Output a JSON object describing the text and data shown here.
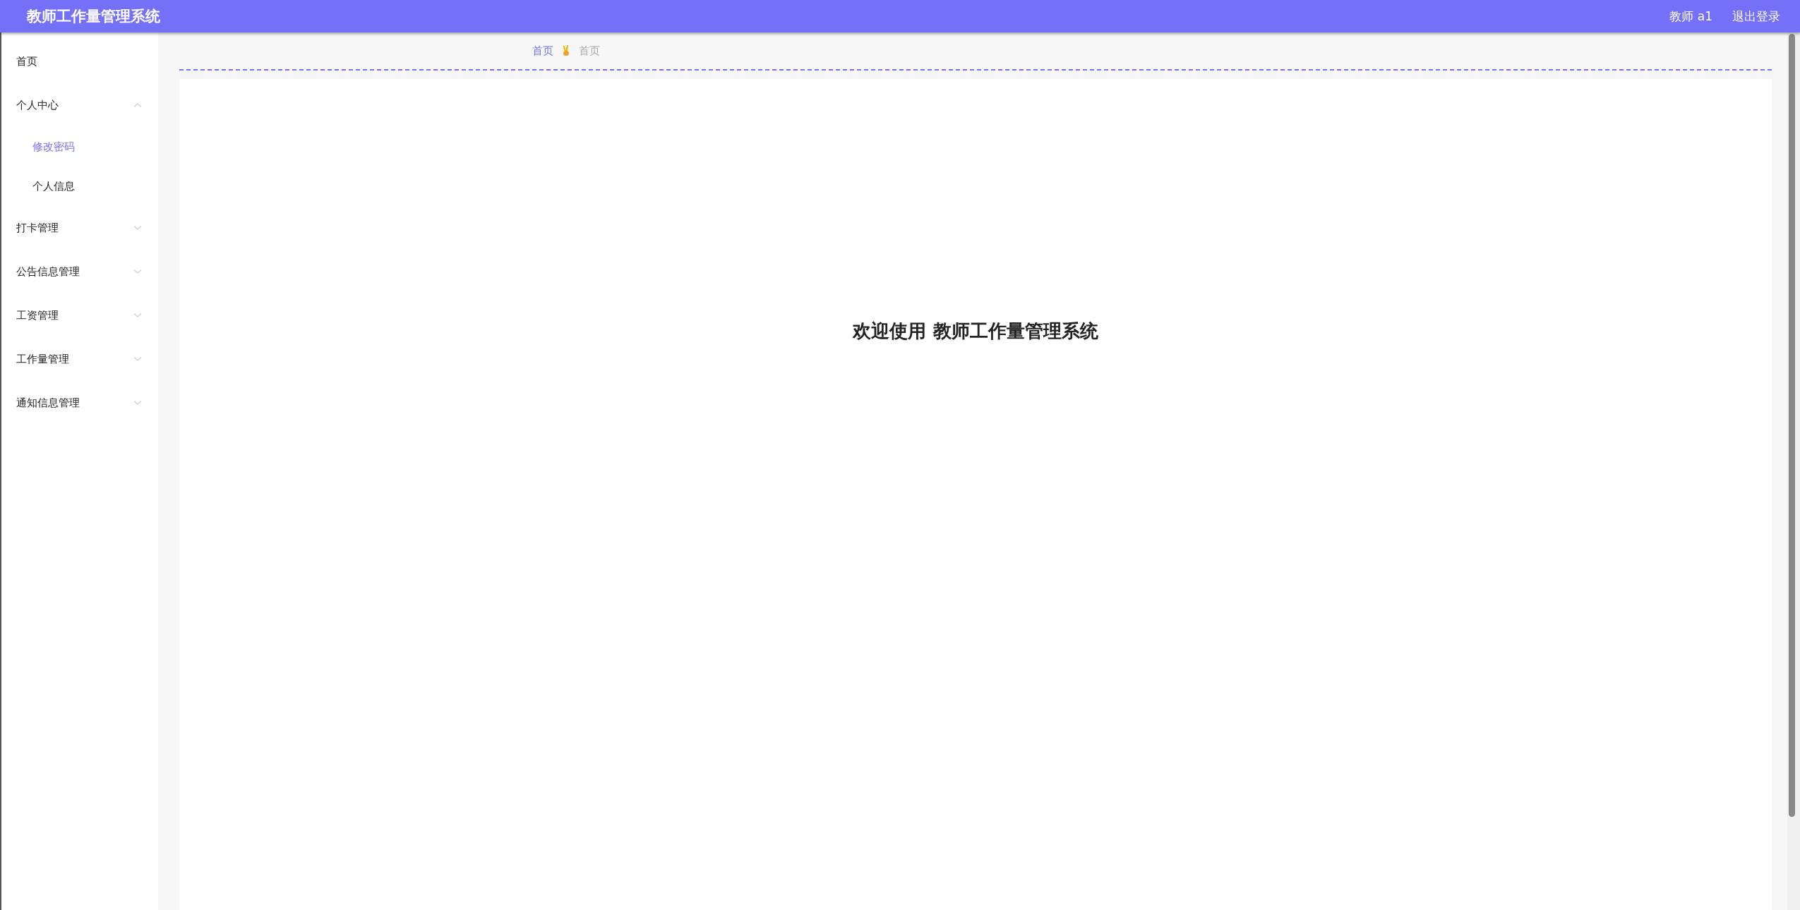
{
  "header": {
    "title": "教师工作量管理系统",
    "user": "教师 a1",
    "logout": "退出登录"
  },
  "sidebar": {
    "items": [
      {
        "kind": "link",
        "label": "首页",
        "selected": false
      },
      {
        "kind": "group",
        "label": "个人中心",
        "expanded": true,
        "children": [
          {
            "label": "修改密码",
            "selected": true
          },
          {
            "label": "个人信息",
            "selected": false
          }
        ]
      },
      {
        "kind": "group",
        "label": "打卡管理",
        "expanded": false
      },
      {
        "kind": "group",
        "label": "公告信息管理",
        "expanded": false
      },
      {
        "kind": "group",
        "label": "工资管理",
        "expanded": false
      },
      {
        "kind": "group",
        "label": "工作量管理",
        "expanded": false
      },
      {
        "kind": "group",
        "label": "通知信息管理",
        "expanded": false
      }
    ]
  },
  "breadcrumb": [
    {
      "label": "首页",
      "current": false
    },
    {
      "label": "首页",
      "current": true
    }
  ],
  "welcome": "欢迎使用 教师工作量管理系统"
}
